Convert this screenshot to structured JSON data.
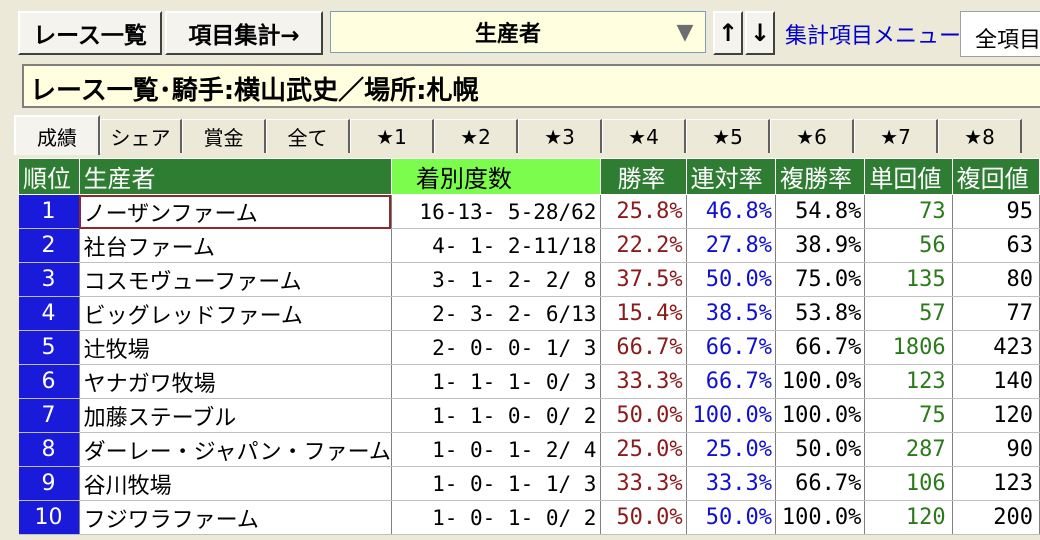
{
  "toolbar": {
    "race_list": "レース一覧",
    "aggregate": "項目集計→",
    "dropdown_value": "生産者",
    "dropdown_arrow": "▼",
    "sort_up": "↑",
    "sort_down": "↓",
    "menu_link": "集計項目メニュー",
    "all_items": "全項目"
  },
  "title": "レース一覧･騎手:横山武史／場所:札幌",
  "tabs": [
    "成績",
    "シェア",
    "賞金",
    "全て",
    "★1",
    "★2",
    "★3",
    "★4",
    "★5",
    "★6",
    "★7",
    "★8"
  ],
  "table": {
    "headers": [
      "順位",
      "生産者",
      "着別度数",
      "勝率",
      "連対率",
      "複勝率",
      "単回値",
      "複回値"
    ],
    "rows": [
      {
        "rank": "1",
        "name": "ノーザンファーム",
        "record": "16-13- 5-28/62",
        "win": "25.8%",
        "rentai": "46.8%",
        "fukusho": "54.8%",
        "tan": "73",
        "fuku": "95"
      },
      {
        "rank": "2",
        "name": "社台ファーム",
        "record": "4- 1- 2-11/18",
        "win": "22.2%",
        "rentai": "27.8%",
        "fukusho": "38.9%",
        "tan": "56",
        "fuku": "63"
      },
      {
        "rank": "3",
        "name": "コスモヴューファーム",
        "record": "3- 1- 2- 2/ 8",
        "win": "37.5%",
        "rentai": "50.0%",
        "fukusho": "75.0%",
        "tan": "135",
        "fuku": "80"
      },
      {
        "rank": "4",
        "name": "ビッグレッドファーム",
        "record": "2- 3- 2- 6/13",
        "win": "15.4%",
        "rentai": "38.5%",
        "fukusho": "53.8%",
        "tan": "57",
        "fuku": "77"
      },
      {
        "rank": "5",
        "name": "辻牧場",
        "record": "2- 0- 0- 1/ 3",
        "win": "66.7%",
        "rentai": "66.7%",
        "fukusho": "66.7%",
        "tan": "1806",
        "fuku": "423"
      },
      {
        "rank": "6",
        "name": "ヤナガワ牧場",
        "record": "1- 1- 1- 0/ 3",
        "win": "33.3%",
        "rentai": "66.7%",
        "fukusho": "100.0%",
        "tan": "123",
        "fuku": "140"
      },
      {
        "rank": "7",
        "name": "加藤ステーブル",
        "record": "1- 1- 0- 0/ 2",
        "win": "50.0%",
        "rentai": "100.0%",
        "fukusho": "100.0%",
        "tan": "75",
        "fuku": "120"
      },
      {
        "rank": "8",
        "name": "ダーレー・ジャパン・ファーム",
        "record": "1- 0- 1- 2/ 4",
        "win": "25.0%",
        "rentai": "25.0%",
        "fukusho": "50.0%",
        "tan": "287",
        "fuku": "90"
      },
      {
        "rank": "9",
        "name": "谷川牧場",
        "record": "1- 0- 1- 1/ 3",
        "win": "33.3%",
        "rentai": "33.3%",
        "fukusho": "66.7%",
        "tan": "106",
        "fuku": "123"
      },
      {
        "rank": "10",
        "name": "フジワラファーム",
        "record": "1- 0- 1- 0/ 2",
        "win": "50.0%",
        "rentai": "50.0%",
        "fukusho": "100.0%",
        "tan": "120",
        "fuku": "200"
      }
    ]
  },
  "colors": {
    "header_bg": "#2e7d32",
    "header_highlight": "#7cfc4c",
    "rank_bg": "#1a1adb",
    "win_text": "#8b1a1a",
    "rentai_text": "#1010d0",
    "tan_text": "#2a7a1a"
  }
}
